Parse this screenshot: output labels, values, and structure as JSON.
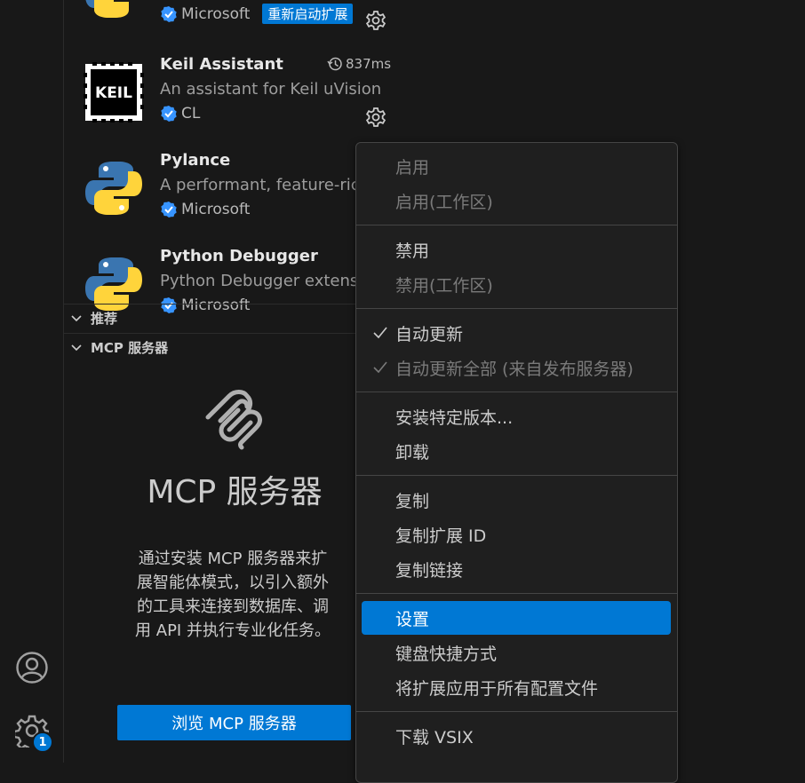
{
  "extensions": [
    {
      "name": "",
      "publisher": "Microsoft",
      "restart_label": "重新启动扩展"
    },
    {
      "name": "Keil Assistant",
      "description": "An assistant for Keil uVision",
      "publisher": "CL",
      "timing": "837ms"
    },
    {
      "name": "Pylance",
      "description": "A performant, feature-rich",
      "publisher": "Microsoft"
    },
    {
      "name": "Python Debugger",
      "description": "Python Debugger extensio",
      "publisher": "Microsoft"
    }
  ],
  "sections": {
    "recommended": "推荐",
    "mcp": "MCP 服务器"
  },
  "mcp_panel": {
    "title": "MCP 服务器",
    "description": "通过安装 MCP 服务器来扩展智能体模式，以引入额外的工具来连接到数据库、调用 API 并执行专业化任务。",
    "browse_button": "浏览 MCP 服务器"
  },
  "activity_bar": {
    "settings_badge": "1"
  },
  "keil_logo_text": "KEIL",
  "context_menu": [
    {
      "label": "启用",
      "state": "disabled"
    },
    {
      "label": "启用(工作区)",
      "state": "disabled"
    },
    {
      "label": "禁用",
      "state": "enabled"
    },
    {
      "label": "禁用(工作区)",
      "state": "disabled"
    },
    {
      "label": "自动更新",
      "state": "enabled",
      "checked": true
    },
    {
      "label": "自动更新全部 (来自发布服务器)",
      "state": "disabled",
      "checked": true
    },
    {
      "label": "安装特定版本...",
      "state": "enabled"
    },
    {
      "label": "卸载",
      "state": "enabled"
    },
    {
      "label": "复制",
      "state": "enabled"
    },
    {
      "label": "复制扩展 ID",
      "state": "enabled"
    },
    {
      "label": "复制链接",
      "state": "enabled"
    },
    {
      "label": "设置",
      "state": "selected"
    },
    {
      "label": "键盘快捷方式",
      "state": "enabled"
    },
    {
      "label": "将扩展应用于所有配置文件",
      "state": "enabled"
    },
    {
      "label": "下载 VSIX",
      "state": "enabled"
    }
  ],
  "colors": {
    "accent": "#0078d4",
    "verified": "#3794ff",
    "python_blue": "#3a75b0",
    "python_yellow": "#ffd43b"
  }
}
